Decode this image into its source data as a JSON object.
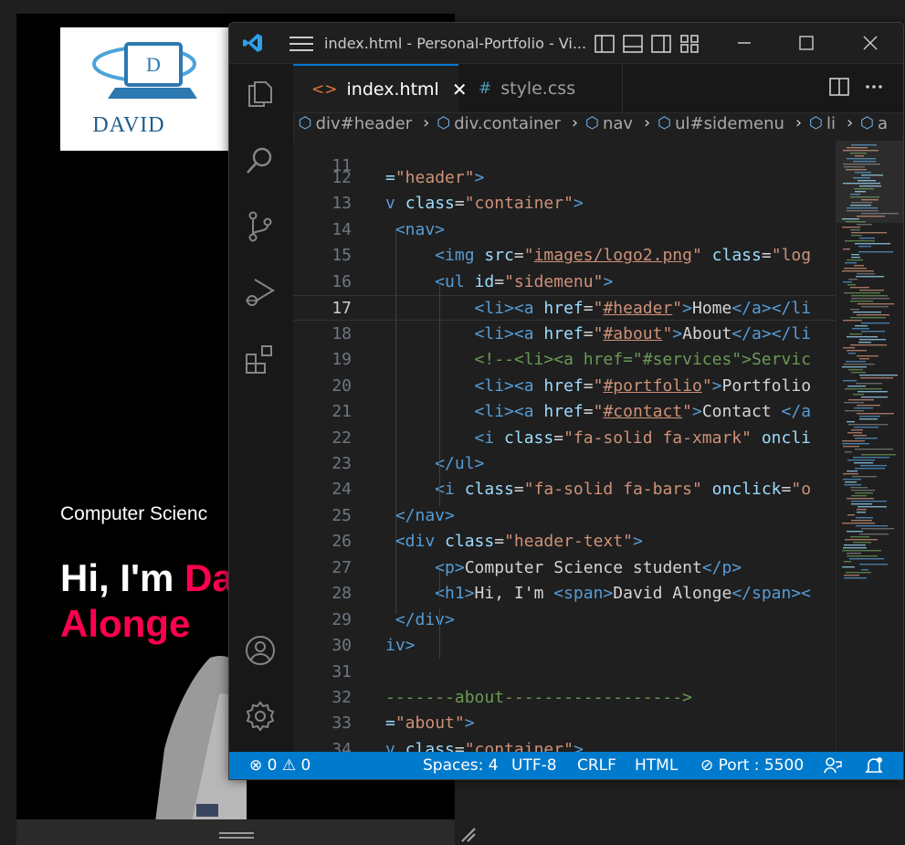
{
  "preview": {
    "logo_text": "DAVID",
    "logo_letter": "D",
    "subtitle": "Computer Scienc",
    "hero_prefix": "Hi, I'm ",
    "hero_highlight_1": "Da",
    "hero_highlight_2": "Alonge"
  },
  "window": {
    "title": "index.html - Personal-Portfolio - Vi..."
  },
  "tabs": [
    {
      "label": "index.html",
      "icon": "<>",
      "active": true
    },
    {
      "label": "style.css",
      "icon": "#",
      "active": false
    }
  ],
  "breadcrumb": [
    "div#header",
    "div.container",
    "nav",
    "ul#sidemenu",
    "li",
    "a"
  ],
  "editor": {
    "partial_top_line": "11",
    "current_line": "17",
    "lines": [
      {
        "n": "12",
        "tokens": [
          {
            "c": "t-attr",
            "t": "="
          },
          {
            "c": "t-str",
            "t": "\"header\""
          },
          {
            "c": "t-tag",
            "t": ">"
          }
        ]
      },
      {
        "n": "13",
        "tokens": [
          {
            "c": "t-tag",
            "t": "v "
          },
          {
            "c": "t-attr",
            "t": "class"
          },
          {
            "c": "t-txt",
            "t": "="
          },
          {
            "c": "t-str",
            "t": "\"container\""
          },
          {
            "c": "t-tag",
            "t": ">"
          }
        ]
      },
      {
        "n": "14",
        "tokens": [
          {
            "c": "t-tag",
            "t": " <nav>"
          }
        ]
      },
      {
        "n": "15",
        "tokens": [
          {
            "c": "t-tag",
            "t": "     <img "
          },
          {
            "c": "t-attr",
            "t": "src"
          },
          {
            "c": "t-txt",
            "t": "="
          },
          {
            "c": "t-str",
            "t": "\""
          },
          {
            "c": "t-str t-ul",
            "t": "images/logo2.png"
          },
          {
            "c": "t-str",
            "t": "\""
          },
          {
            "c": "t-txt",
            "t": " "
          },
          {
            "c": "t-attr",
            "t": "class"
          },
          {
            "c": "t-txt",
            "t": "="
          },
          {
            "c": "t-str",
            "t": "\"log"
          }
        ]
      },
      {
        "n": "16",
        "tokens": [
          {
            "c": "t-tag",
            "t": "     <ul "
          },
          {
            "c": "t-attr",
            "t": "id"
          },
          {
            "c": "t-txt",
            "t": "="
          },
          {
            "c": "t-str",
            "t": "\"sidemenu\""
          },
          {
            "c": "t-tag",
            "t": ">"
          }
        ]
      },
      {
        "n": "17",
        "tokens": [
          {
            "c": "t-tag",
            "t": "         <li><a "
          },
          {
            "c": "t-attr",
            "t": "href"
          },
          {
            "c": "t-txt",
            "t": "="
          },
          {
            "c": "t-str",
            "t": "\""
          },
          {
            "c": "t-str t-ul",
            "t": "#header"
          },
          {
            "c": "t-str",
            "t": "\""
          },
          {
            "c": "t-tag",
            "t": ">"
          },
          {
            "c": "t-txt",
            "t": "Home"
          },
          {
            "c": "t-tag",
            "t": "</a></li"
          }
        ]
      },
      {
        "n": "18",
        "tokens": [
          {
            "c": "t-tag",
            "t": "         <li><a "
          },
          {
            "c": "t-attr",
            "t": "href"
          },
          {
            "c": "t-txt",
            "t": "="
          },
          {
            "c": "t-str",
            "t": "\""
          },
          {
            "c": "t-str t-ul",
            "t": "#about"
          },
          {
            "c": "t-str",
            "t": "\""
          },
          {
            "c": "t-tag",
            "t": ">"
          },
          {
            "c": "t-txt",
            "t": "About"
          },
          {
            "c": "t-tag",
            "t": "</a></li"
          }
        ]
      },
      {
        "n": "19",
        "tokens": [
          {
            "c": "t-cm",
            "t": "         <!--<li><a href=\"#services\">Servic"
          }
        ]
      },
      {
        "n": "20",
        "tokens": [
          {
            "c": "t-tag",
            "t": "         <li><a "
          },
          {
            "c": "t-attr",
            "t": "href"
          },
          {
            "c": "t-txt",
            "t": "="
          },
          {
            "c": "t-str",
            "t": "\""
          },
          {
            "c": "t-str t-ul",
            "t": "#portfolio"
          },
          {
            "c": "t-str",
            "t": "\""
          },
          {
            "c": "t-tag",
            "t": ">"
          },
          {
            "c": "t-txt",
            "t": "Portfolio"
          }
        ]
      },
      {
        "n": "21",
        "tokens": [
          {
            "c": "t-tag",
            "t": "         <li><a "
          },
          {
            "c": "t-attr",
            "t": "href"
          },
          {
            "c": "t-txt",
            "t": "="
          },
          {
            "c": "t-str",
            "t": "\""
          },
          {
            "c": "t-str t-ul",
            "t": "#contact"
          },
          {
            "c": "t-str",
            "t": "\""
          },
          {
            "c": "t-tag",
            "t": ">"
          },
          {
            "c": "t-txt",
            "t": "Contact "
          },
          {
            "c": "t-tag",
            "t": "</a"
          }
        ]
      },
      {
        "n": "22",
        "tokens": [
          {
            "c": "t-tag",
            "t": "         <i "
          },
          {
            "c": "t-attr",
            "t": "class"
          },
          {
            "c": "t-txt",
            "t": "="
          },
          {
            "c": "t-str",
            "t": "\"fa-solid fa-xmark\""
          },
          {
            "c": "t-txt",
            "t": " "
          },
          {
            "c": "t-attr",
            "t": "oncli"
          }
        ]
      },
      {
        "n": "23",
        "tokens": [
          {
            "c": "t-tag",
            "t": "     </ul>"
          }
        ]
      },
      {
        "n": "24",
        "tokens": [
          {
            "c": "t-tag",
            "t": "     <i "
          },
          {
            "c": "t-attr",
            "t": "class"
          },
          {
            "c": "t-txt",
            "t": "="
          },
          {
            "c": "t-str",
            "t": "\"fa-solid fa-bars\""
          },
          {
            "c": "t-txt",
            "t": " "
          },
          {
            "c": "t-attr",
            "t": "onclick"
          },
          {
            "c": "t-txt",
            "t": "="
          },
          {
            "c": "t-str",
            "t": "\"o"
          }
        ]
      },
      {
        "n": "25",
        "tokens": [
          {
            "c": "t-tag",
            "t": " </nav>"
          }
        ]
      },
      {
        "n": "26",
        "tokens": [
          {
            "c": "t-tag",
            "t": " <div "
          },
          {
            "c": "t-attr",
            "t": "class"
          },
          {
            "c": "t-txt",
            "t": "="
          },
          {
            "c": "t-str",
            "t": "\"header-text\""
          },
          {
            "c": "t-tag",
            "t": ">"
          }
        ]
      },
      {
        "n": "27",
        "tokens": [
          {
            "c": "t-tag",
            "t": "     <p>"
          },
          {
            "c": "t-txt",
            "t": "Computer Science student"
          },
          {
            "c": "t-tag",
            "t": "</p>"
          }
        ]
      },
      {
        "n": "28",
        "tokens": [
          {
            "c": "t-tag",
            "t": "     <h1>"
          },
          {
            "c": "t-txt",
            "t": "Hi, I'm "
          },
          {
            "c": "t-tag",
            "t": "<span>"
          },
          {
            "c": "t-txt",
            "t": "David Alonge"
          },
          {
            "c": "t-tag",
            "t": "</span><"
          }
        ]
      },
      {
        "n": "29",
        "tokens": [
          {
            "c": "t-tag",
            "t": " </div>"
          }
        ]
      },
      {
        "n": "30",
        "tokens": [
          {
            "c": "t-tag",
            "t": "iv>"
          }
        ]
      },
      {
        "n": "31",
        "tokens": []
      },
      {
        "n": "32",
        "tokens": [
          {
            "c": "t-cm",
            "t": "-------about------------------>"
          }
        ]
      },
      {
        "n": "33",
        "tokens": [
          {
            "c": "t-attr",
            "t": "="
          },
          {
            "c": "t-str",
            "t": "\"about\""
          },
          {
            "c": "t-tag",
            "t": ">"
          }
        ]
      },
      {
        "n": "34",
        "tokens": [
          {
            "c": "t-tag",
            "t": "v "
          },
          {
            "c": "t-attr",
            "t": "class"
          },
          {
            "c": "t-txt",
            "t": "="
          },
          {
            "c": "t-str",
            "t": "\"container\""
          },
          {
            "c": "t-tag",
            "t": ">"
          }
        ]
      }
    ]
  },
  "statusbar": {
    "errors": "0",
    "warnings": "0",
    "spaces": "Spaces: 4",
    "encoding": "UTF-8",
    "eol": "CRLF",
    "language": "HTML",
    "port": "Port : 5500"
  },
  "colors": {
    "accent": "#007acc",
    "highlight": "#ff004f",
    "tag": "#569cd6",
    "attr": "#9cdcfe",
    "string": "#ce9178",
    "comment": "#6a9955"
  }
}
